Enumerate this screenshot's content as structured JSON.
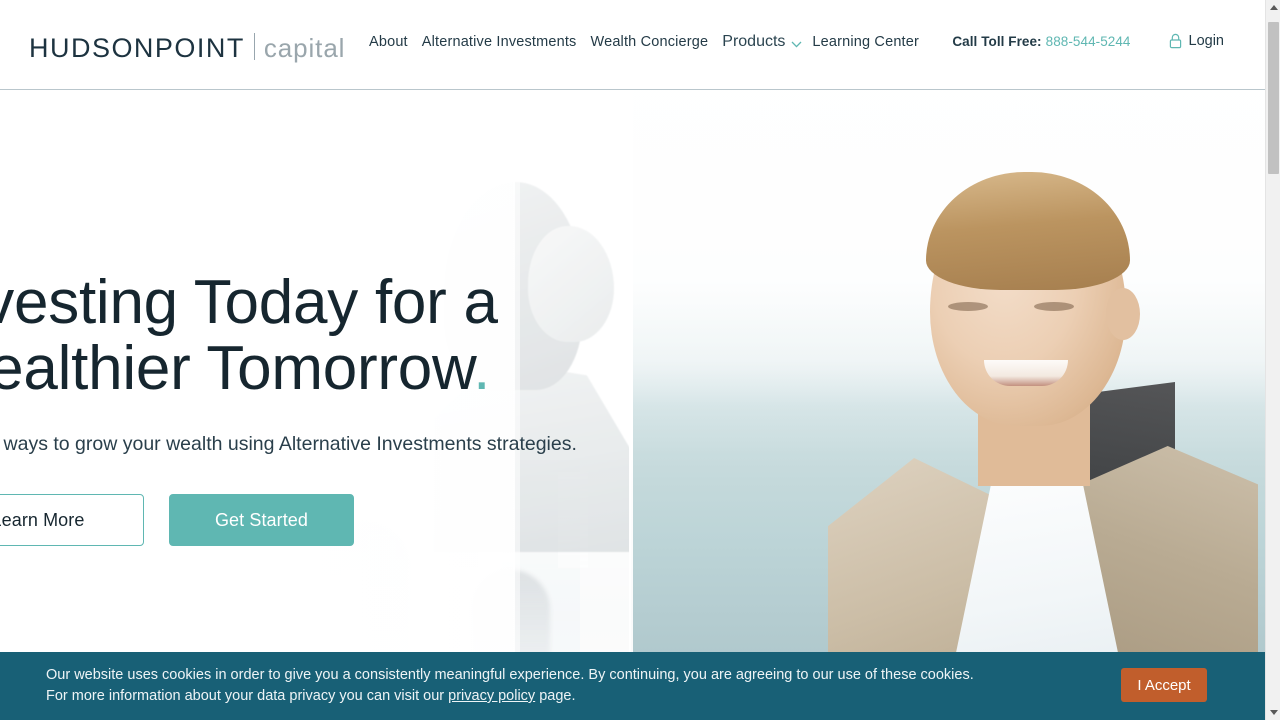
{
  "header": {
    "logo": {
      "main": "HUDSONPOINT",
      "sub": "capital"
    },
    "nav": [
      {
        "label": "About",
        "name": "nav-about"
      },
      {
        "label": "Alternative Investments",
        "name": "nav-alternative-investments"
      },
      {
        "label": "Wealth Concierge",
        "name": "nav-wealth-concierge"
      }
    ],
    "products": {
      "label": "Products",
      "icon": "chevron-down-icon"
    },
    "learning_center": "Learning Center",
    "toll_free_label": "Call Toll Free:",
    "toll_free_number": "888-544-5244",
    "login_label": "Login",
    "login_icon": "lock-icon"
  },
  "hero": {
    "headline_line1": "Investing Today for a",
    "headline_line2": "Wealthier Tomorrow",
    "headline_dot": ".",
    "subhead": "Explore ways to grow your wealth using Alternative Investments strategies.",
    "btn_learn_more": "Learn More",
    "btn_get_started": "Get Started"
  },
  "cookie": {
    "line1": "Our website uses cookies in order to give you a consistently meaningful experience. By continuing, you are agreeing to our use of these cookies.",
    "line2_before": "For more information about your data privacy you can visit our ",
    "privacy_link": "privacy policy",
    "line2_after": " page.",
    "accept_label": "I Accept"
  },
  "colors": {
    "teal": "#5fb7b2",
    "navy": "#16262f",
    "banner_bg": "#186076",
    "accept_orange": "#c15e2c",
    "logo_gray": "#9aa6ac"
  }
}
